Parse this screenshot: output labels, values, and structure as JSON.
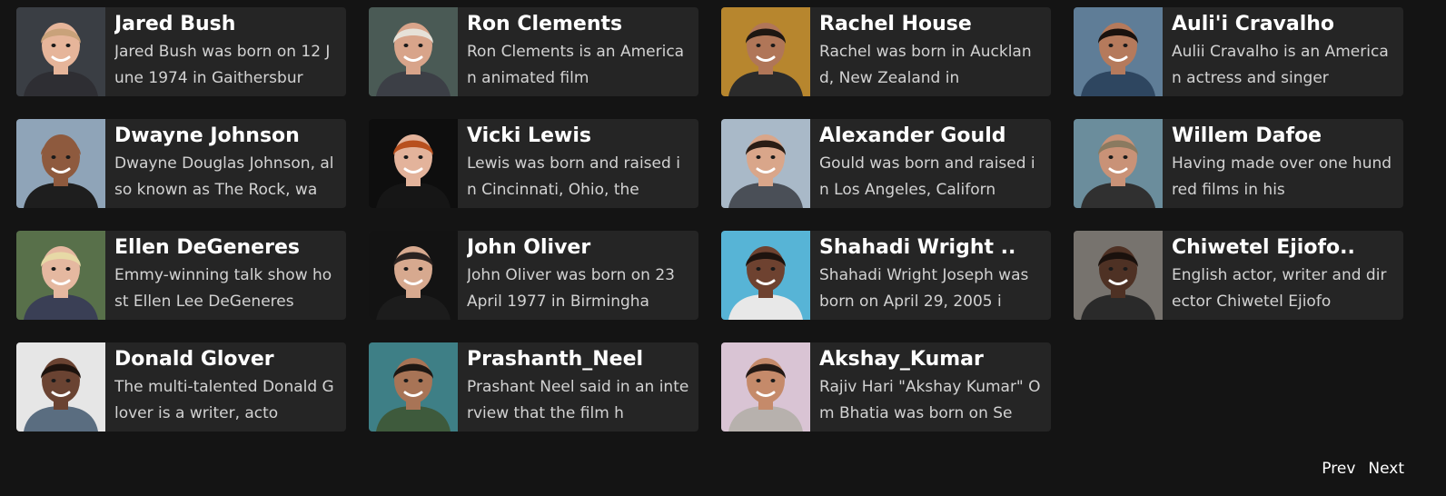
{
  "cards": [
    {
      "name": "Jared Bush",
      "bio": "Jared Bush was born on 12 June 1974 in Gaithersbur",
      "photo_icon": "person-photo-icon",
      "bg": "#3a3e44",
      "skin": "#e6b59a",
      "hair": "#c9a27a",
      "shirt": "#2e2e33"
    },
    {
      "name": "Ron Clements",
      "bio": "Ron Clements is an American animated film",
      "photo_icon": "person-photo-icon",
      "bg": "#4a5a55",
      "skin": "#d8a48a",
      "hair": "#e6e1d8",
      "shirt": "#3c3f46"
    },
    {
      "name": "Rachel House",
      "bio": "Rachel was born in Auckland, New Zealand in",
      "photo_icon": "person-photo-icon",
      "bg": "#b7862e",
      "skin": "#b07658",
      "hair": "#1e1712",
      "shirt": "#2b2b2b"
    },
    {
      "name": "Auli'i Cravalho",
      "bio": "Aulii Cravalho is an American actress and singer",
      "photo_icon": "person-photo-icon",
      "bg": "#5f7d97",
      "skin": "#b57a5c",
      "hair": "#1a120e",
      "shirt": "#2e4660"
    },
    {
      "name": "Dwayne Johnson",
      "bio": "Dwayne Douglas Johnson, also known as The Rock, wa",
      "photo_icon": "person-photo-icon",
      "bg": "#8fa4b8",
      "skin": "#8e5a3e",
      "hair": "#8e5a3e",
      "shirt": "#1e1e1e"
    },
    {
      "name": "Vicki Lewis",
      "bio": "Lewis was born and raised in Cincinnati, Ohio, the",
      "photo_icon": "person-photo-icon",
      "bg": "#0e0e0e",
      "skin": "#e3b39b",
      "hair": "#b8501e",
      "shirt": "#161616"
    },
    {
      "name": "Alexander Gould",
      "bio": "Gould was born and raised in Los Angeles, Californ",
      "photo_icon": "person-photo-icon",
      "bg": "#a9b9c8",
      "skin": "#d9a68a",
      "hair": "#2a1d15",
      "shirt": "#4a4f57"
    },
    {
      "name": "Willem Dafoe",
      "bio": "Having made over one hundred films in his",
      "photo_icon": "person-photo-icon",
      "bg": "#6b8d9c",
      "skin": "#c99277",
      "hair": "#8a7a60",
      "shirt": "#303030"
    },
    {
      "name": "Ellen DeGeneres",
      "bio": "Emmy-winning talk show host Ellen Lee DeGeneres",
      "photo_icon": "person-photo-icon",
      "bg": "#58704a",
      "skin": "#e5b8a0",
      "hair": "#e7d9a6",
      "shirt": "#3a3f55"
    },
    {
      "name": "John Oliver",
      "bio": "John Oliver was born on 23 April 1977 in Birmingha",
      "photo_icon": "person-photo-icon",
      "bg": "#131313",
      "skin": "#d7a98f",
      "hair": "#2a2220",
      "shirt": "#1c1c1c"
    },
    {
      "name": "Shahadi Wright ..",
      "bio": "Shahadi Wright Joseph was born on April 29, 2005 i",
      "photo_icon": "person-photo-icon",
      "bg": "#57b4d6",
      "skin": "#6e4230",
      "hair": "#1e130e",
      "shirt": "#e8e8e8"
    },
    {
      "name": "Chiwetel Ejiofo..",
      "bio": "English actor, writer and director Chiwetel Ejiofo",
      "photo_icon": "person-photo-icon",
      "bg": "#77736e",
      "skin": "#4e3124",
      "hair": "#1a110d",
      "shirt": "#2a2a2a"
    },
    {
      "name": "Donald Glover",
      "bio": "The multi-talented Donald Glover is a writer, acto",
      "photo_icon": "person-photo-icon",
      "bg": "#e6e6e6",
      "skin": "#6a4332",
      "hair": "#1d130e",
      "shirt": "#5a6d80"
    },
    {
      "name": "Prashanth_Neel",
      "bio": "Prashant Neel said in an interview that the film h",
      "photo_icon": "person-photo-icon",
      "bg": "#3e7f86",
      "skin": "#a87456",
      "hair": "#1d1713",
      "shirt": "#3e5a3c"
    },
    {
      "name": "Akshay_Kumar",
      "bio": "Rajiv Hari \"Akshay Kumar\" Om Bhatia was born on Se",
      "photo_icon": "person-photo-icon",
      "bg": "#d9c4d4",
      "skin": "#c58a6a",
      "hair": "#231915",
      "shirt": "#b7b1ad"
    }
  ],
  "pager": {
    "prev_label": "Prev",
    "next_label": "Next"
  }
}
